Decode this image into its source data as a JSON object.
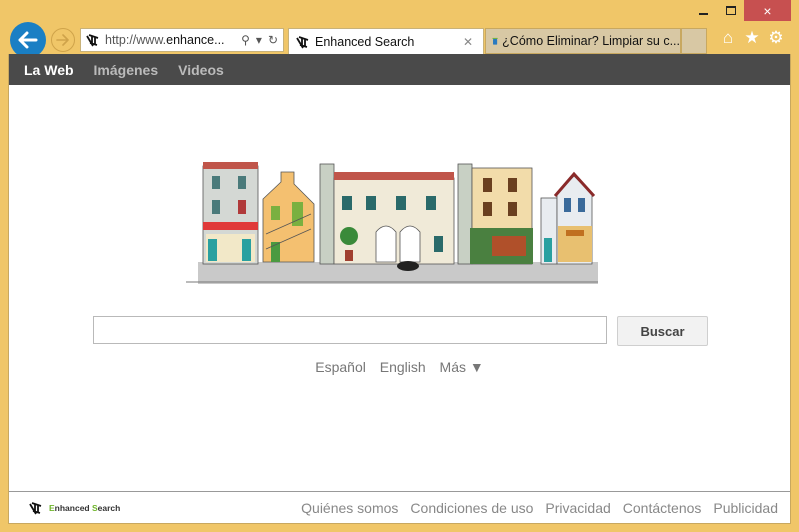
{
  "window": {
    "controls": {
      "minimize": "minimize",
      "maximize": "maximize",
      "close": "×"
    }
  },
  "navigation": {
    "back_icon": "arrow-left-icon",
    "forward_icon": "arrow-right-icon",
    "address": {
      "prefix": "http://www.",
      "domain": "enhance..."
    },
    "address_tools": {
      "search": "⚲",
      "dropdown": "▾",
      "refresh": "↻"
    }
  },
  "tabs": [
    {
      "label": "Enhanced Search",
      "close": "✕",
      "active": true
    },
    {
      "label": "¿Cómo Eliminar? Limpiar su c...",
      "active": false
    }
  ],
  "browser_tools": {
    "home": "⌂",
    "favorites": "★",
    "settings": "⚙"
  },
  "topnav": {
    "items": [
      {
        "label": "La Web",
        "active": true
      },
      {
        "label": "Imágenes",
        "active": false
      },
      {
        "label": "Videos",
        "active": false
      }
    ]
  },
  "search": {
    "value": "",
    "placeholder": "",
    "button_label": "Buscar"
  },
  "languages": {
    "items": [
      "Español",
      "English"
    ],
    "more_label": "Más ▼"
  },
  "footer": {
    "logo": {
      "first_letter": "E",
      "first_rest": "nhanced ",
      "second_letter": "S",
      "second_rest": "earch"
    },
    "links": [
      "Quiénes somos",
      "Condiciones de uso",
      "Privacidad",
      "Contáctenos",
      "Publicidad"
    ]
  },
  "colors": {
    "frame": "#f0c668",
    "back_button": "#1a7fc4",
    "close_button": "#c75050",
    "topnav_bg": "#4a4a4a",
    "logo_accent": "#6fb52b"
  }
}
